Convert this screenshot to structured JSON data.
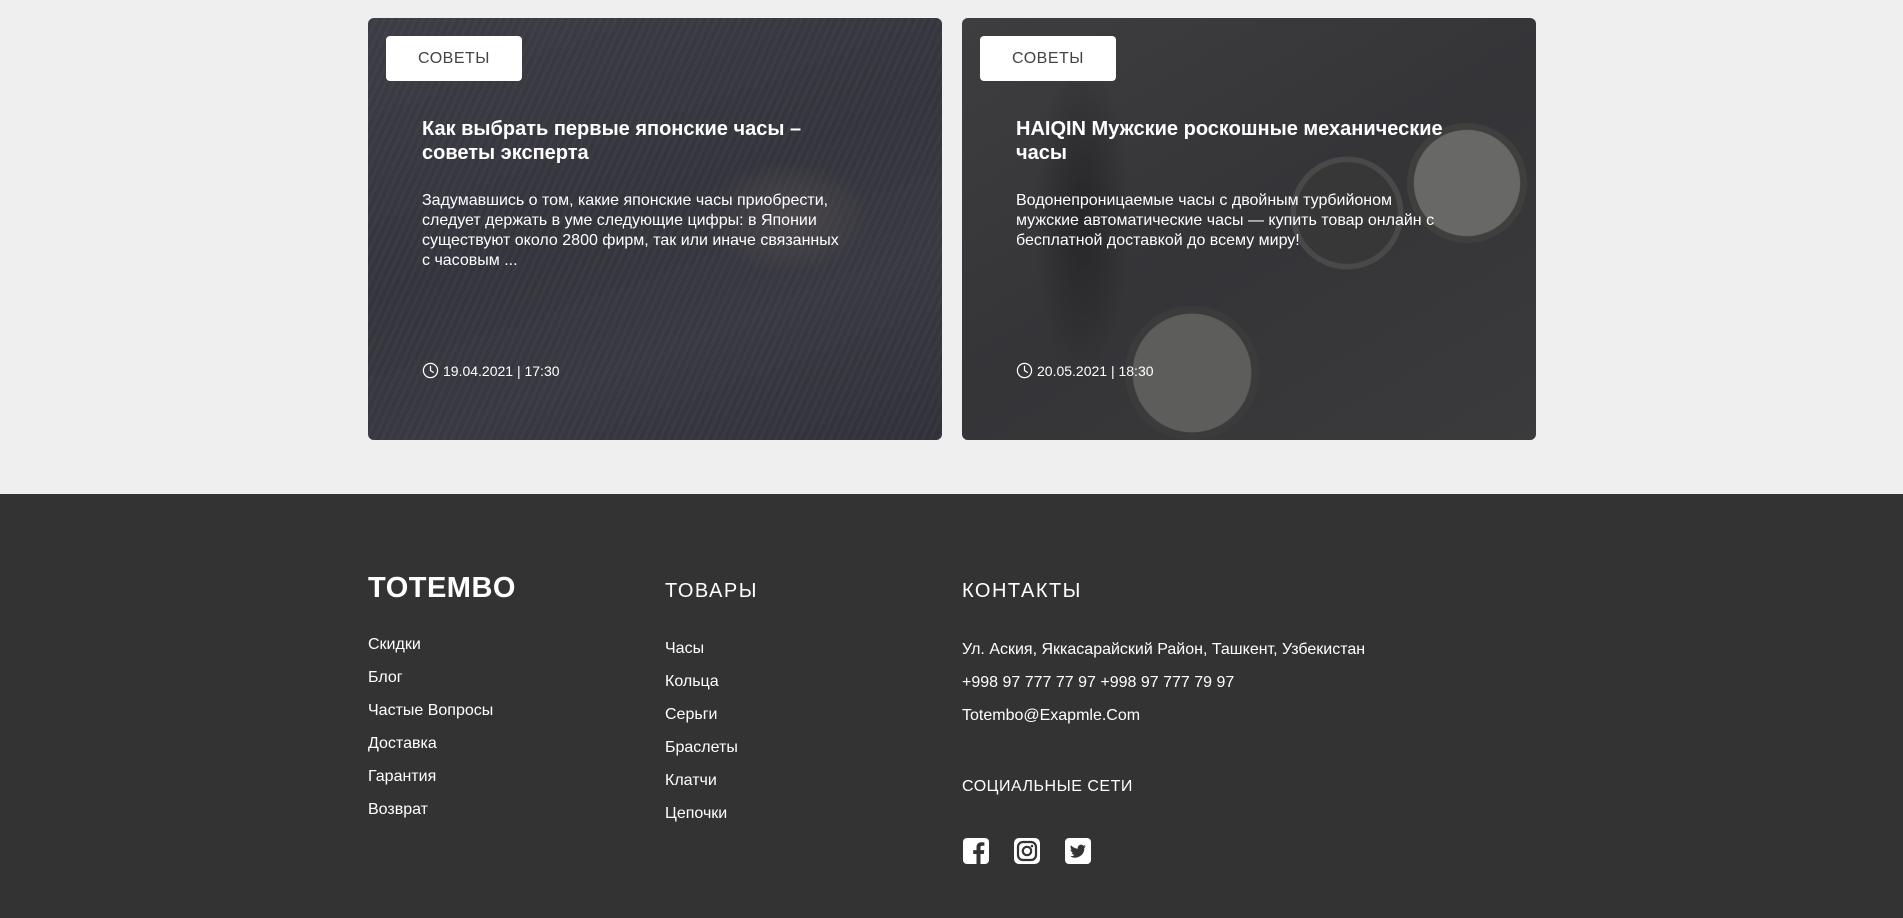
{
  "articles": [
    {
      "tag": "СОВЕТЫ",
      "title": "Как выбрать первые японские часы – советы эксперта",
      "excerpt": "Задумавшись о том, какие японские часы приобрести, следует держать в уме следующие цифры: в Японии существуют около 2800 фирм, так или иначе связанных с часовым ...",
      "date": "19.04.2021 | 17:30"
    },
    {
      "tag": "СОВЕТЫ",
      "title": "HAIQIN Мужские роскошные механические часы",
      "excerpt": "Водонепроницаемые часы с двойным турбийоном мужские автоматические часы — купить товар онлайн с бесплатной доставкой до всему миру!",
      "date": "20.05.2021 | 18:30"
    }
  ],
  "footer": {
    "logo": "TOTEMBO",
    "info_links": [
      "Скидки",
      "Блог",
      "Частые Вопросы",
      "Доставка",
      "Гарантия",
      "Возврат"
    ],
    "products_title": "ТОВАРЫ",
    "products": [
      "Часы",
      "Кольца",
      "Серьги",
      "Браслеты",
      "Клатчи",
      "Цепочки"
    ],
    "contacts_title": "КОНТАКТЫ",
    "address": "Ул. Аския, Яккасарайский Район, Ташкент, Узбекистан",
    "phones": "+998 97 777 77 97  +998 97 777 79 97",
    "email": "Totembo@Exapmle.Com",
    "social_title": "СОЦИАЛЬНЫЕ СЕТИ",
    "social_icons": [
      "facebook-icon",
      "instagram-icon",
      "twitter-icon"
    ]
  },
  "colors": {
    "page_bg": "#efefef",
    "footer_bg": "#333333",
    "text_light": "#ffffff"
  }
}
